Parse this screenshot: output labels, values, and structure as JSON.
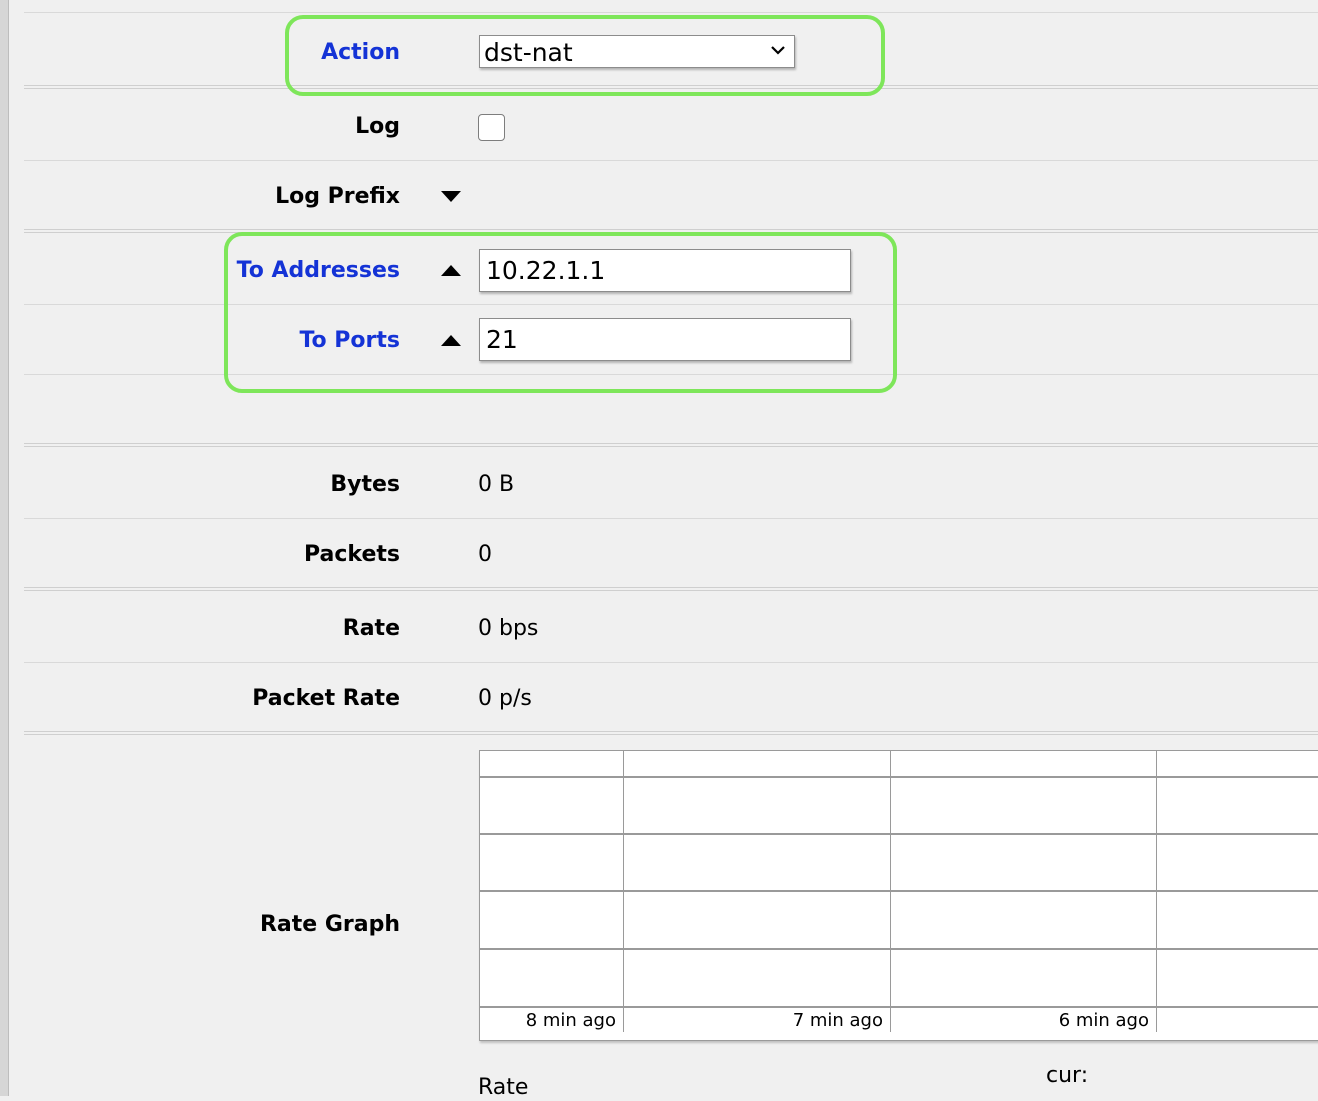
{
  "form": {
    "action": {
      "label": "Action",
      "selected": "dst-nat",
      "icon": "chevron-down-icon"
    },
    "log": {
      "label": "Log",
      "checked": false
    },
    "log_prefix": {
      "label": "Log Prefix",
      "icon": "caret-down-icon"
    },
    "to_addresses": {
      "label": "To Addresses",
      "value": "10.22.1.1",
      "icon": "caret-up-icon"
    },
    "to_ports": {
      "label": "To Ports",
      "value": "21",
      "icon": "caret-up-icon"
    }
  },
  "stats": {
    "bytes": {
      "label": "Bytes",
      "value": "0 B"
    },
    "packets": {
      "label": "Packets",
      "value": "0"
    },
    "rate": {
      "label": "Rate",
      "value": "0 bps"
    },
    "packet_rate": {
      "label": "Packet Rate",
      "value": "0 p/s"
    }
  },
  "rate_graph": {
    "label": "Rate Graph",
    "time_labels": [
      "8 min ago",
      "7 min ago",
      "6 min ago"
    ],
    "legend_label": "Rate",
    "cur_label": "cur:"
  },
  "colors": {
    "highlight": "#7ee65a",
    "blue_label": "#1433d6",
    "background": "#f0f0f0"
  }
}
